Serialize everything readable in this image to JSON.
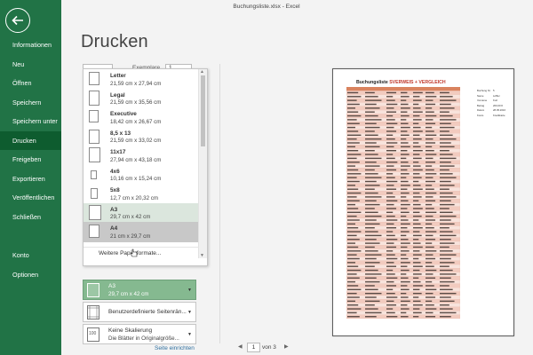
{
  "window": {
    "title": "Buchungsliste.xlsx - Excel"
  },
  "sidebar": {
    "items": [
      {
        "label": "Informationen"
      },
      {
        "label": "Neu"
      },
      {
        "label": "Öffnen"
      },
      {
        "label": "Speichern"
      },
      {
        "label": "Speichern unter"
      },
      {
        "label": "Drucken"
      },
      {
        "label": "Freigeben"
      },
      {
        "label": "Exportieren"
      },
      {
        "label": "Veröffentlichen"
      },
      {
        "label": "Schließen"
      },
      {
        "label": "Konto"
      },
      {
        "label": "Optionen"
      }
    ],
    "active": "Drucken"
  },
  "page": {
    "title": "Drucken"
  },
  "copies": {
    "label": "Exemplare",
    "value": "1"
  },
  "paper_sizes": [
    {
      "name": "Letter",
      "size": "21,59 cm x 27,94 cm"
    },
    {
      "name": "Legal",
      "size": "21,59 cm x 35,56 cm"
    },
    {
      "name": "Executive",
      "size": "18,42 cm x 26,67 cm"
    },
    {
      "name": "8,5 x 13",
      "size": "21,59 cm x 33,02 cm"
    },
    {
      "name": "11x17",
      "size": "27,94 cm x 43,18 cm"
    },
    {
      "name": "4x6",
      "size": "10,16 cm x 15,24 cm"
    },
    {
      "name": "5x8",
      "size": "12,7 cm x 20,32 cm"
    },
    {
      "name": "A3",
      "size": "29,7 cm x 42 cm"
    },
    {
      "name": "A4",
      "size": "21 cm x 29,7 cm"
    }
  ],
  "paper_selected": "A3",
  "paper_hovered": "A4",
  "more_formats": "Weitere Papierformate...",
  "settings": {
    "paper": {
      "line1": "A3",
      "line2": "29,7 cm x 42 cm"
    },
    "margins": {
      "line1": "Benutzerdefinierte Seitenrän..."
    },
    "scaling": {
      "line1": "Keine Skalierung",
      "line2": "Die Blätter in Originalgröße..."
    },
    "page_setup_link": "Seite einrichten"
  },
  "preview": {
    "title_prefix": "Buchungsliste",
    "title_suffix": "SVERWEIS + VERGLEICH",
    "info": [
      {
        "label": "Buchung Nr.",
        "value": "5"
      },
      {
        "label": "Name",
        "value": "Löffler"
      },
      {
        "label": "Vorname",
        "value": "Kurt"
      },
      {
        "label": "Betrag",
        "value": "200,00 €"
      },
      {
        "label": "Datum",
        "value": "28.05.2016"
      },
      {
        "label": "Konto",
        "value": "Kreditkarte"
      }
    ]
  },
  "pager": {
    "current": "1",
    "of_text": "von 3"
  },
  "colors": {
    "accent": "#217346",
    "accent_dark": "#0e5c2f",
    "selected": "#85b990",
    "row_band": "#f2cbbf",
    "title_red": "#c0392b"
  }
}
